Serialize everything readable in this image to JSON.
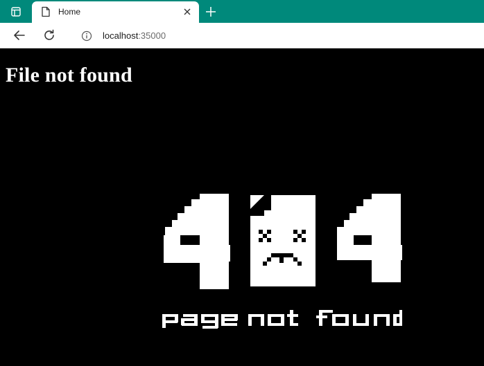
{
  "browser": {
    "tab_title": "Home",
    "url_host": "localhost",
    "url_port": ":35000"
  },
  "page": {
    "heading": "File not found",
    "error_code_left": "4",
    "error_code_right": "4",
    "caption_words": [
      "page",
      "not",
      "found"
    ]
  },
  "colors": {
    "tabbar": "#00897b",
    "page_bg": "#000000",
    "text": "#ffffff"
  }
}
